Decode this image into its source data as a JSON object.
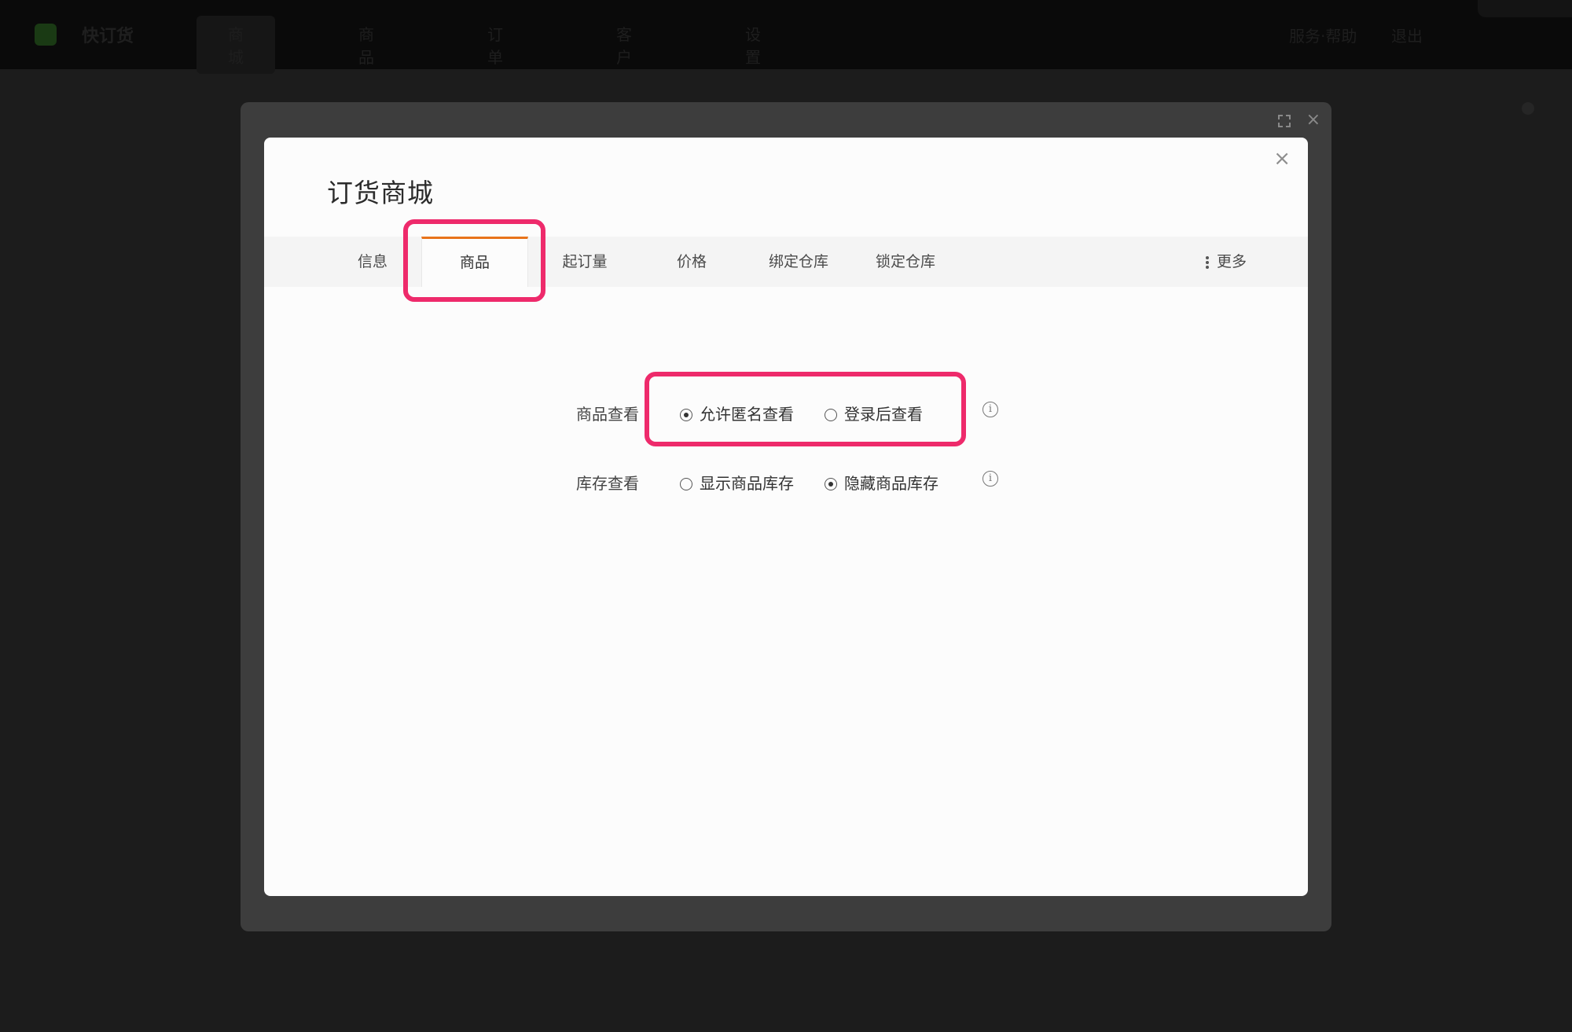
{
  "app": {
    "brand": "快订货",
    "nav": [
      "商城",
      "商品",
      "订单",
      "客户",
      "设置"
    ],
    "topright": [
      "服务·帮助",
      "退出"
    ]
  },
  "dialog": {
    "title": "订货商城",
    "close_glyph": "×",
    "tabs": [
      "信息",
      "商品",
      "起订量",
      "价格",
      "绑定仓库",
      "锁定仓库"
    ],
    "active_tab": "商品",
    "more_label": "更多"
  },
  "settings": {
    "product_view": {
      "label": "商品查看",
      "options": [
        "允许匿名查看",
        "登录后查看"
      ],
      "selected": "允许匿名查看"
    },
    "stock_view": {
      "label": "库存查看",
      "options": [
        "显示商品库存",
        "隐藏商品库存"
      ],
      "selected": "隐藏商品库存"
    }
  },
  "colors": {
    "highlight": "#ee2a6b",
    "tab_accent": "#e8731a",
    "overlay": "#1c1c1c"
  }
}
